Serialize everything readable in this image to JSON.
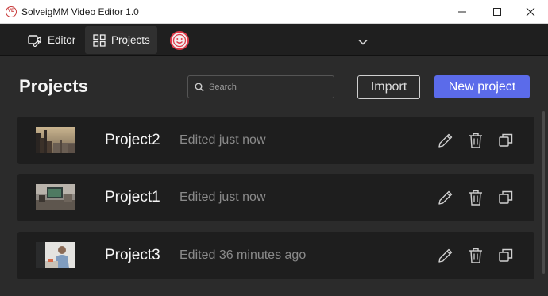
{
  "window": {
    "app_icon_text": "VE",
    "title": "SolveigMM Video Editor 1.0"
  },
  "nav": {
    "tabs": [
      {
        "label": "Editor",
        "icon": "video-edit-icon"
      },
      {
        "label": "Projects",
        "icon": "grid-icon"
      }
    ],
    "active_tab": "Projects",
    "account_icon": "smiley-icon",
    "menu_icon": "chevron-down-icon"
  },
  "main": {
    "title": "Projects",
    "search": {
      "placeholder": "Search",
      "value": ""
    },
    "import_label": "Import",
    "new_project_label": "New project"
  },
  "projects": [
    {
      "name": "Project2",
      "status": "Edited just now",
      "thumbnail": "city-skyline"
    },
    {
      "name": "Project1",
      "status": "Edited just now",
      "thumbnail": "desk-monitor"
    },
    {
      "name": "Project3",
      "status": "Edited 36 minutes ago",
      "thumbnail": "person-portrait"
    }
  ],
  "row_actions": [
    "pencil-icon",
    "trash-icon",
    "duplicate-icon"
  ],
  "colors": {
    "accent": "#5b6bea",
    "background": "#2b2b2b",
    "row_background": "#1e1e1e",
    "navbar": "#1f1f1f",
    "muted_text": "#8a8a8a"
  }
}
